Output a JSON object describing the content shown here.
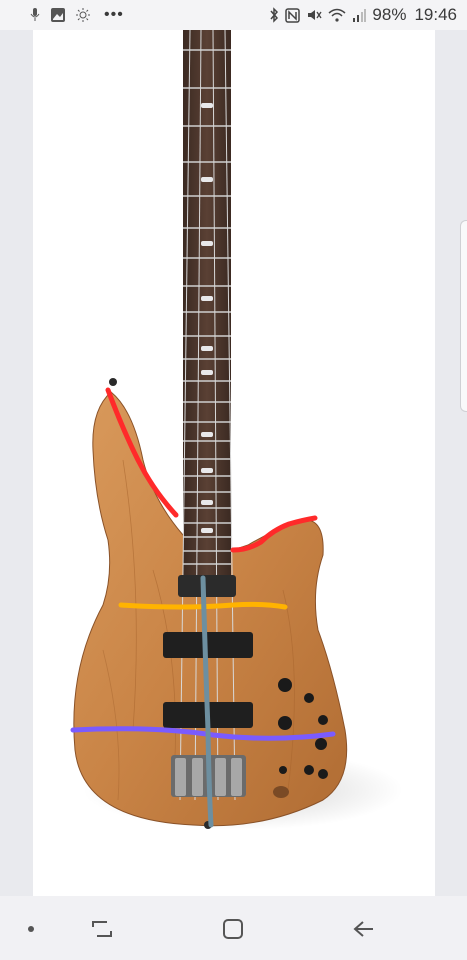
{
  "status_bar": {
    "left_icons": [
      "microphone-icon",
      "gallery-icon",
      "weather-icon",
      "more-icon"
    ],
    "right_icons": [
      "bluetooth-icon",
      "nfc-icon",
      "vibrate-mute-icon",
      "wifi-icon",
      "signal-icon"
    ],
    "battery": "98%",
    "time": "19:46"
  },
  "viewer": {
    "image_subject": "bass-guitar-photo",
    "annotation_colors": {
      "red": "#ff2a2a",
      "orange": "#ffb300",
      "purple": "#7a5bff",
      "blue_gray": "#6d8fa0"
    }
  },
  "nav_bar": {
    "items": [
      "home-dot-icon",
      "recent-apps-icon",
      "home-icon",
      "back-icon"
    ]
  }
}
